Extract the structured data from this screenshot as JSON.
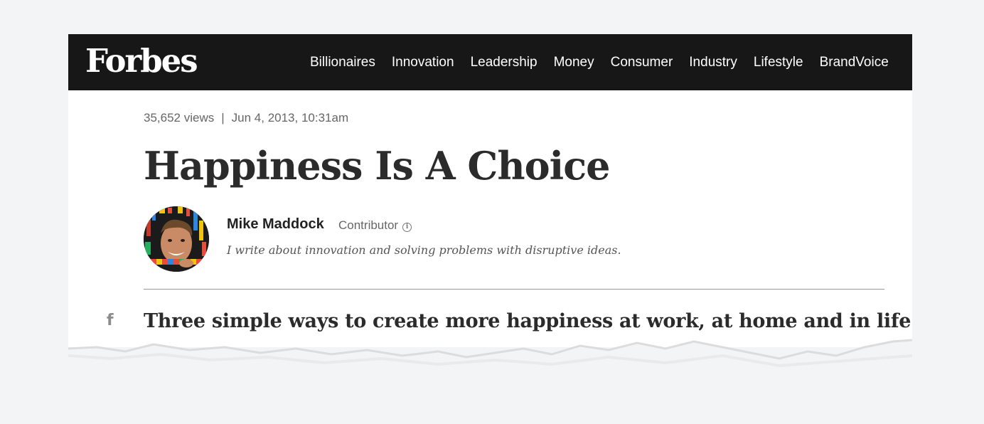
{
  "header": {
    "logo": "Forbes",
    "nav": [
      "Billionaires",
      "Innovation",
      "Leadership",
      "Money",
      "Consumer",
      "Industry",
      "Lifestyle",
      "BrandVoice"
    ]
  },
  "article": {
    "views": "35,652 views",
    "separator": "|",
    "date": "Jun 4, 2013, 10:31am",
    "title": "Happiness Is A Choice",
    "subheadline": "Three simple ways to create more happiness at work, at home and in life"
  },
  "author": {
    "name": "Mike Maddock",
    "role": "Contributor",
    "bio": "I write about innovation and solving problems with disruptive ideas."
  },
  "icons": {
    "social": "facebook-icon",
    "info": "info-icon"
  },
  "colors": {
    "topbar": "#171717",
    "background": "#f3f4f6",
    "text": "#2b2b2b"
  }
}
